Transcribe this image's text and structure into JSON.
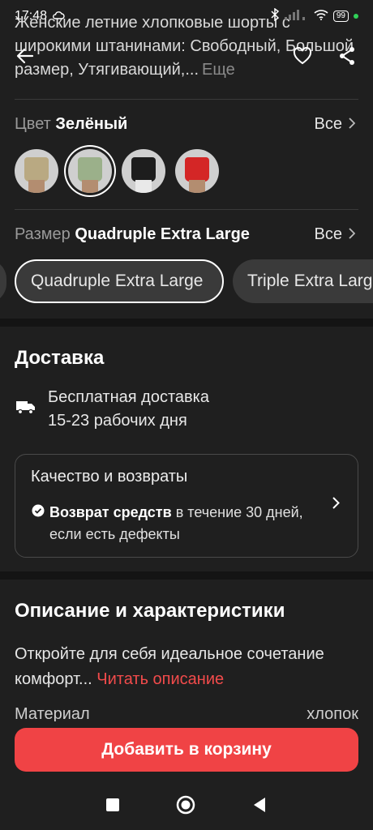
{
  "status_bar": {
    "time": "17:48",
    "battery": "99"
  },
  "product": {
    "title": "Женские летние хлопковые шорты с широкими штанинами: Свободный, Большой размер, Утягивающий,...",
    "more": "Еще"
  },
  "color": {
    "label": "Цвет",
    "value": "Зелёный",
    "all": "Все",
    "swatches": [
      {
        "name": "khaki",
        "color": "#b9a982"
      },
      {
        "name": "green",
        "color": "#9bb08a"
      },
      {
        "name": "black",
        "color": "#1d1d1d"
      },
      {
        "name": "red",
        "color": "#d42626"
      }
    ]
  },
  "size": {
    "label": "Размер",
    "value": "Quadruple Extra Large",
    "all": "Все",
    "chips": [
      "Quadruple Extra Large",
      "Triple Extra Large"
    ]
  },
  "delivery": {
    "title": "Доставка",
    "line1": "Бесплатная доставка",
    "line2": "15-23 рабочих дня",
    "quality_title": "Качество и возвраты",
    "refund_bold": "Возврат средств",
    "refund_text": "в течение 30 дней, если есть дефекты"
  },
  "description": {
    "title": "Описание и характеристики",
    "text": "Откройте для себя идеальное сочетание комфорт...",
    "read_more": "Читать описание",
    "material_label": "Материал",
    "material_value": "хлопок"
  },
  "cart": {
    "button_label": "Добавить в корзину"
  },
  "colors": {
    "accent": "#f04345",
    "background": "#1f1f1f"
  }
}
